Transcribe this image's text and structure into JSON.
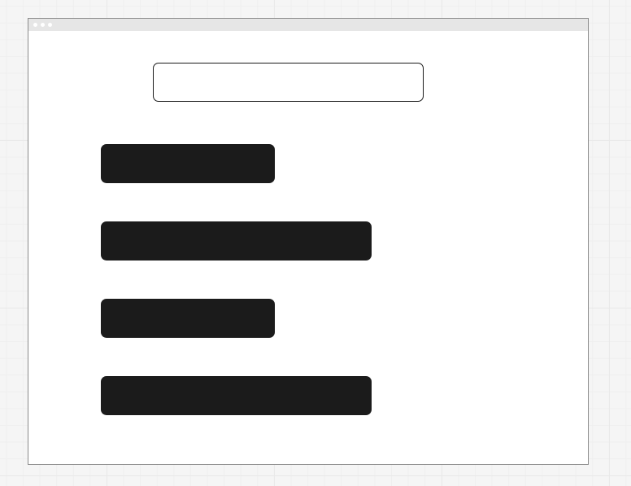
{
  "window": {
    "controls": [
      "window-dot",
      "window-dot",
      "window-dot"
    ]
  },
  "search": {
    "value": "",
    "placeholder": ""
  },
  "buttons": [
    {
      "label": ""
    },
    {
      "label": ""
    },
    {
      "label": ""
    },
    {
      "label": ""
    }
  ],
  "colors": {
    "background": "#f5f5f5",
    "window": "#ffffff",
    "title_bar": "#e6e6e6",
    "button_fill": "#1b1b1b",
    "border": "#1a1a1a"
  }
}
